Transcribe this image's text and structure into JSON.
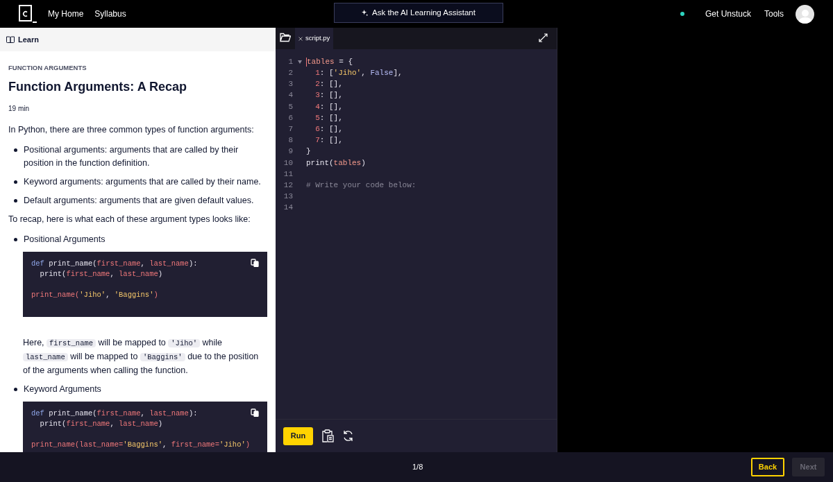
{
  "nav": {
    "links": [
      "My Home",
      "Syllabus"
    ],
    "assistant": "Ask the AI Learning Assistant",
    "right_links": [
      "Get Unstuck",
      "Tools"
    ]
  },
  "learn": {
    "header": "Learn",
    "eyebrow": "FUNCTION ARGUMENTS",
    "title": "Function Arguments: A Recap",
    "duration": "19 min",
    "blocks": [
      {
        "kind": "para",
        "segments": [
          {
            "kind": "text",
            "text": "In Python, there are three common types of function arguments:"
          }
        ]
      },
      {
        "kind": "bullet",
        "segments": [
          {
            "kind": "text",
            "text": "Positional arguments: arguments that are called by their position in the function definition."
          }
        ]
      },
      {
        "kind": "bullet",
        "segments": [
          {
            "kind": "text",
            "text": "Keyword arguments: arguments that are called by their name."
          }
        ]
      },
      {
        "kind": "bullet",
        "segments": [
          {
            "kind": "text",
            "text": "Default arguments: arguments that are given default values."
          }
        ]
      },
      {
        "kind": "para",
        "segments": [
          {
            "kind": "text",
            "text": "To recap, here is what each of these argument types looks like:"
          }
        ]
      },
      {
        "kind": "bullet",
        "segments": [
          {
            "kind": "text",
            "text": "Positional Arguments"
          }
        ]
      },
      {
        "kind": "code",
        "lines": [
          {
            "kind": "code",
            "tokens": [
              {
                "kind": "kw",
                "text": "def "
              },
              {
                "kind": "fn",
                "text": "print_name("
              },
              {
                "kind": "param",
                "text": "first_name"
              },
              {
                "kind": "plain",
                "text": ", "
              },
              {
                "kind": "param",
                "text": "last_name"
              },
              {
                "kind": "fn",
                "text": "):"
              }
            ]
          },
          {
            "kind": "code",
            "indent": true,
            "tokens": [
              {
                "kind": "plain",
                "text": "print("
              },
              {
                "kind": "param",
                "text": "first_name"
              },
              {
                "kind": "plain",
                "text": ", "
              },
              {
                "kind": "param",
                "text": "last_name"
              },
              {
                "kind": "plain",
                "text": ")"
              }
            ]
          },
          {
            "kind": "blank"
          },
          {
            "kind": "code",
            "tokens": [
              {
                "kind": "param",
                "text": "print_name("
              },
              {
                "kind": "str",
                "text": "'Jiho'"
              },
              {
                "kind": "plain",
                "text": ", "
              },
              {
                "kind": "str",
                "text": "'Baggins'"
              },
              {
                "kind": "param",
                "text": ")"
              }
            ]
          }
        ]
      },
      {
        "kind": "indent",
        "segments": [
          {
            "kind": "text",
            "text": "Here, "
          },
          {
            "kind": "code",
            "text": "first_name"
          },
          {
            "kind": "text",
            "text": " will be mapped to "
          },
          {
            "kind": "code",
            "text": "'Jiho'"
          },
          {
            "kind": "text",
            "text": " while "
          },
          {
            "kind": "code",
            "text": "last_name"
          },
          {
            "kind": "text",
            "text": " will be mapped to "
          },
          {
            "kind": "code",
            "text": "'Baggins'"
          },
          {
            "kind": "text",
            "text": " due to the position of the arguments when calling the function."
          }
        ]
      },
      {
        "kind": "bullet",
        "segments": [
          {
            "kind": "text",
            "text": "Keyword Arguments"
          }
        ]
      },
      {
        "kind": "code",
        "lines": [
          {
            "kind": "code",
            "tokens": [
              {
                "kind": "kw",
                "text": "def "
              },
              {
                "kind": "fn",
                "text": "print_name("
              },
              {
                "kind": "param",
                "text": "first_name"
              },
              {
                "kind": "plain",
                "text": ", "
              },
              {
                "kind": "param",
                "text": "last_name"
              },
              {
                "kind": "fn",
                "text": "):"
              }
            ]
          },
          {
            "kind": "code",
            "indent": true,
            "tokens": [
              {
                "kind": "plain",
                "text": "print("
              },
              {
                "kind": "param",
                "text": "first_name"
              },
              {
                "kind": "plain",
                "text": ", "
              },
              {
                "kind": "param",
                "text": "last_name"
              },
              {
                "kind": "plain",
                "text": ")"
              }
            ]
          },
          {
            "kind": "blank"
          },
          {
            "kind": "code",
            "tokens": [
              {
                "kind": "param",
                "text": "print_name(last_name="
              },
              {
                "kind": "str",
                "text": "'Baggins'"
              },
              {
                "kind": "plain",
                "text": ", "
              },
              {
                "kind": "param",
                "text": "first_name="
              },
              {
                "kind": "str",
                "text": "'Jiho'"
              },
              {
                "kind": "param",
                "text": ")"
              }
            ]
          }
        ]
      }
    ]
  },
  "editor": {
    "tab": "script.py",
    "lines": [
      {
        "number": "1",
        "foldable": true,
        "tokens": [
          {
            "kind": "var",
            "text": "tables"
          },
          {
            "kind": "plain",
            "text": " = {"
          }
        ]
      },
      {
        "number": "2",
        "foldable": false,
        "indent": true,
        "tokens": [
          {
            "kind": "num",
            "text": "1"
          },
          {
            "kind": "plain",
            "text": ": ["
          },
          {
            "kind": "str",
            "text": "'Jiho'"
          },
          {
            "kind": "plain",
            "text": ", "
          },
          {
            "kind": "bool",
            "text": "False"
          },
          {
            "kind": "plain",
            "text": "],"
          }
        ]
      },
      {
        "number": "3",
        "foldable": false,
        "indent": true,
        "tokens": [
          {
            "kind": "num",
            "text": "2"
          },
          {
            "kind": "plain",
            "text": ": [],"
          }
        ]
      },
      {
        "number": "4",
        "foldable": false,
        "indent": true,
        "tokens": [
          {
            "kind": "num",
            "text": "3"
          },
          {
            "kind": "plain",
            "text": ": [],"
          }
        ]
      },
      {
        "number": "5",
        "foldable": false,
        "indent": true,
        "tokens": [
          {
            "kind": "num",
            "text": "4"
          },
          {
            "kind": "plain",
            "text": ": [],"
          }
        ]
      },
      {
        "number": "6",
        "foldable": false,
        "indent": true,
        "tokens": [
          {
            "kind": "num",
            "text": "5"
          },
          {
            "kind": "plain",
            "text": ": [],"
          }
        ]
      },
      {
        "number": "7",
        "foldable": false,
        "indent": true,
        "tokens": [
          {
            "kind": "num",
            "text": "6"
          },
          {
            "kind": "plain",
            "text": ": [],"
          }
        ]
      },
      {
        "number": "8",
        "foldable": false,
        "indent": true,
        "tokens": [
          {
            "kind": "num",
            "text": "7"
          },
          {
            "kind": "plain",
            "text": ": [],"
          }
        ]
      },
      {
        "number": "9",
        "foldable": false,
        "tokens": [
          {
            "kind": "plain",
            "text": "}"
          }
        ]
      },
      {
        "number": "10",
        "foldable": false,
        "tokens": [
          {
            "kind": "plain",
            "text": "print("
          },
          {
            "kind": "var",
            "text": "tables"
          },
          {
            "kind": "plain",
            "text": ")"
          }
        ]
      },
      {
        "number": "11",
        "foldable": false
      },
      {
        "number": "12",
        "foldable": false,
        "tokens": [
          {
            "kind": "comment",
            "text": "# Write your code below:"
          }
        ]
      },
      {
        "number": "13",
        "foldable": false
      },
      {
        "number": "14",
        "foldable": false
      }
    ],
    "run": "Run"
  },
  "footer": {
    "progress": "1/8",
    "back": "Back",
    "next": "Next",
    "next_disabled": true
  }
}
